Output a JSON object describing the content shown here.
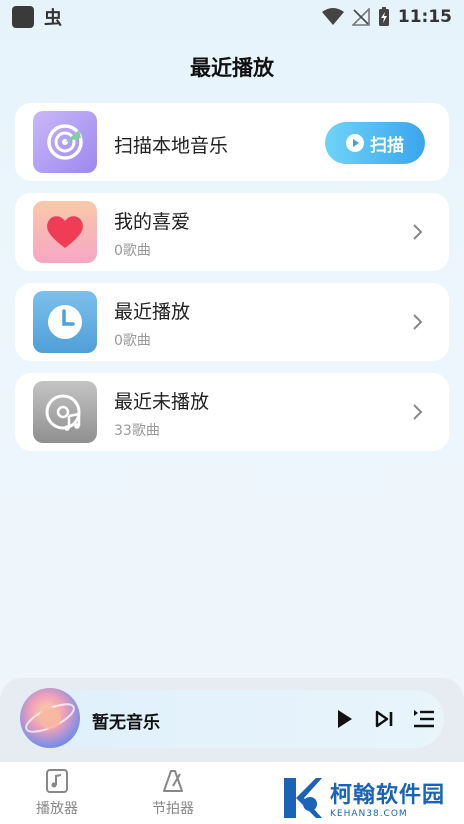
{
  "status": {
    "time": "11:15",
    "app_glyph": "虫"
  },
  "page_title": "最近播放",
  "cards": [
    {
      "title": "扫描本地音乐",
      "button_label": "扫描",
      "icon": "radar-scan-icon"
    },
    {
      "title": "我的喜爱",
      "subtitle": "0歌曲",
      "icon": "heart-icon"
    },
    {
      "title": "最近播放",
      "subtitle": "0歌曲",
      "icon": "clock-icon"
    },
    {
      "title": "最近未播放",
      "subtitle": "33歌曲",
      "icon": "disc-music-icon"
    }
  ],
  "player": {
    "title": "暂无音乐"
  },
  "tabs": [
    {
      "label": "播放器",
      "icon": "music-note-icon"
    },
    {
      "label": "节拍器",
      "icon": "metronome-icon"
    }
  ],
  "watermark": {
    "main": "柯翰软件园",
    "sub": "KEHAN38.COM"
  },
  "colors": {
    "accent": "#3aa5ee",
    "watermark": "#1a63b8"
  }
}
